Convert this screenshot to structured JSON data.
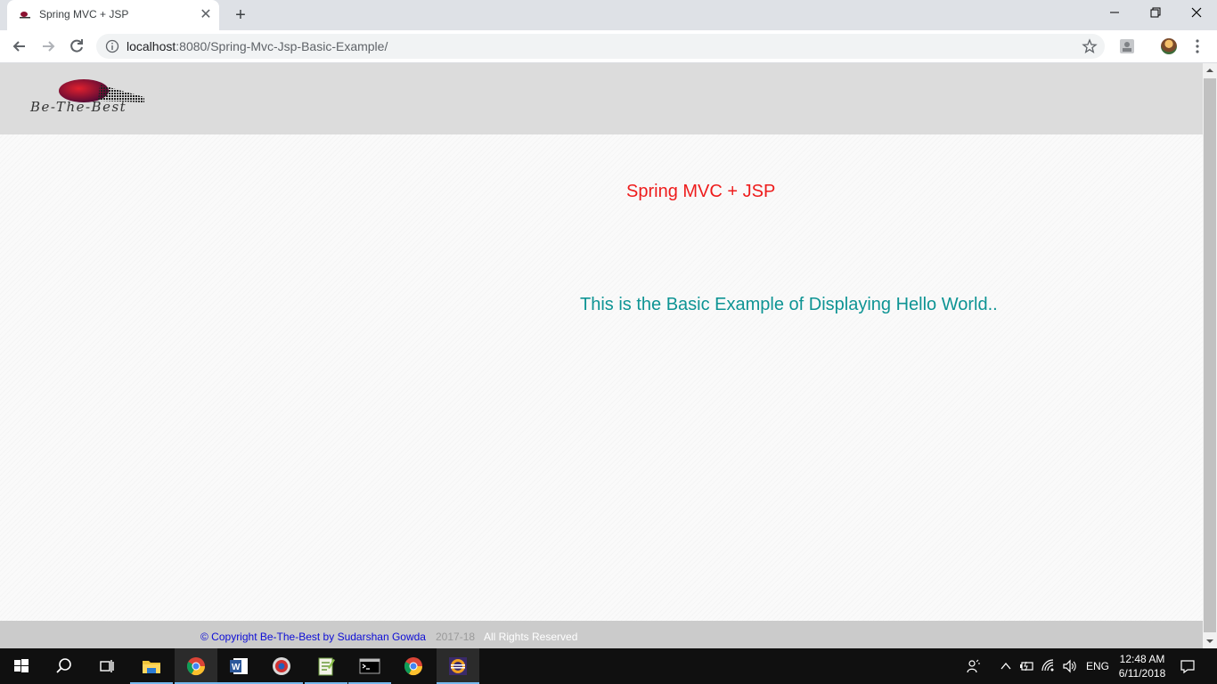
{
  "browser": {
    "tab": {
      "title": "Spring MVC + JSP"
    },
    "url": {
      "host": "localhost",
      "rest": ":8080/Spring-Mvc-Jsp-Basic-Example/"
    }
  },
  "page": {
    "logo_text": "Be-The-Best",
    "title": "Spring MVC + JSP",
    "message": "This is the Basic Example of Displaying Hello World..",
    "footer": {
      "copyright": "© Copyright Be-The-Best by Sudarshan Gowda",
      "year": "2017-18",
      "rights": "All Rights Reserved"
    },
    "colors": {
      "title": "#ee1c1c",
      "message": "#0e9494",
      "footer_link": "#0d0dd6"
    }
  },
  "taskbar": {
    "language": "ENG",
    "time": "12:48 AM",
    "date": "6/11/2018",
    "apps": [
      "windows-start-icon",
      "search-icon",
      "task-view-icon",
      "file-explorer-icon",
      "chrome-icon",
      "word-icon",
      "app-icon",
      "notepadpp-icon",
      "cmd-icon",
      "chrome-icon",
      "eclipse-icon"
    ]
  }
}
